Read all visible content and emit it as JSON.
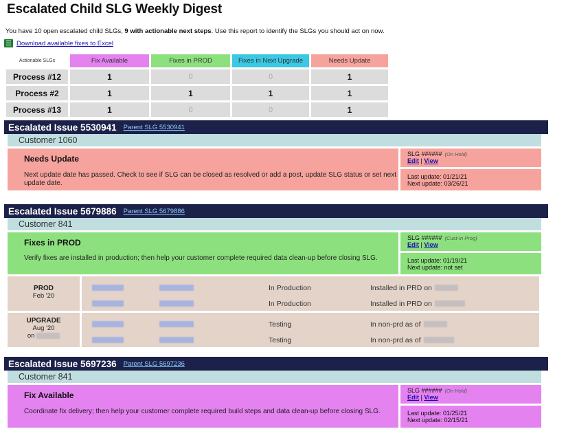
{
  "page": {
    "title": "Escalated Child SLG Weekly Digest",
    "intro_prefix": "You have 10 open escalated child SLGs, ",
    "intro_bold": "9 with actionable next steps",
    "intro_suffix": ". Use this report to identify the SLGs you should act on now.",
    "excel_link": "Download available fixes to Excel"
  },
  "summary": {
    "headers": [
      "Actionable SLGs",
      "Fix Available",
      "Fixes in PROD",
      "Fixes in Next Upgrade",
      "Needs Update"
    ],
    "header_colors": [
      "#ffffff",
      "#e482f0",
      "#8de07e",
      "#3ac8e3",
      "#f7a39d"
    ],
    "rows": [
      {
        "name": "Process #12",
        "values": [
          "1",
          "0",
          "0",
          "1"
        ]
      },
      {
        "name": "Process #2",
        "values": [
          "1",
          "1",
          "1",
          "1"
        ]
      },
      {
        "name": "Process #13",
        "values": [
          "1",
          "0",
          "0",
          "1"
        ]
      }
    ]
  },
  "issues": [
    {
      "title": "Escalated Issue 5530941",
      "parent_link": "Parent SLG 5530941",
      "customer": "Customer 1060",
      "status": "Needs Update",
      "description": "Next update date has passed. Check to see if SLG can be closed as resolved or add a post, update SLG status or set next update date.",
      "slg": "SLG ######",
      "slg_state": "(On Hold)",
      "edit": "Edit",
      "view": "View",
      "last_update": "Last update: 01/21/21",
      "next_update": "Next update: 03/26/21"
    },
    {
      "title": "Escalated Issue 5679886",
      "parent_link": "Parent SLG 5679886",
      "customer": "Customer 841",
      "status": "Fixes in PROD",
      "description": "Verify fixes are installed in production; then help your customer complete required data clean-up before closing SLG.",
      "slg": "SLG ######",
      "slg_state": "(Cust-In Prog)",
      "edit": "Edit",
      "view": "View",
      "last_update": "Last update: 01/19/21",
      "next_update": "Next update: not set",
      "details": [
        {
          "env": "PROD",
          "date": "Feb '20",
          "on": "",
          "lines": [
            {
              "status": "In Production",
              "note": "Installed in PRD on"
            },
            {
              "status": "In Production",
              "note": "Installed in PRD on"
            }
          ]
        },
        {
          "env": "UPGRADE",
          "date": "Aug '20",
          "on": "on",
          "lines": [
            {
              "status": "Testing",
              "note": "In non-prd as of"
            },
            {
              "status": "Testing",
              "note": "In non-prd as of"
            }
          ]
        }
      ]
    },
    {
      "title": "Escalated Issue 5697236",
      "parent_link": "Parent SLG 5697236",
      "customer": "Customer 841",
      "status": "Fix Available",
      "description": "Coordinate fix delivery; then help your customer complete required build steps and data clean-up before closing SLG.",
      "slg": "SLG ######",
      "slg_state": "(On Hold)",
      "edit": "Edit",
      "view": "View",
      "last_update": "Last update: 01/25/21",
      "next_update": "Next update: 02/15/21"
    }
  ]
}
